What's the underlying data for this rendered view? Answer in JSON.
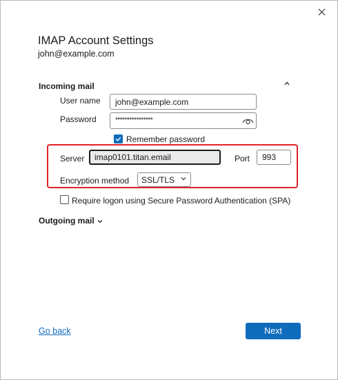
{
  "dialog": {
    "close_icon": "close-icon",
    "title": "IMAP Account Settings",
    "account_email": "john@example.com"
  },
  "incoming": {
    "heading": "Incoming mail",
    "collapse_icon": "chevron-up-icon",
    "user_name_label": "User name",
    "user_name_value": "john@example.com",
    "password_label": "Password",
    "password_value": "****************",
    "reveal_icon": "eye-icon",
    "remember_password_label": "Remember password",
    "remember_password_checked": true,
    "server_label": "Server",
    "server_value": "imap0101.titan.email",
    "port_label": "Port",
    "port_value": "993",
    "encryption_label": "Encryption method",
    "encryption_value": "SSL/TLS",
    "spa_label": "Require logon using Secure Password Authentication (SPA)",
    "spa_checked": false
  },
  "outgoing": {
    "heading": "Outgoing mail",
    "expand_icon": "chevron-down-icon"
  },
  "footer": {
    "back_label": "Go back",
    "next_label": "Next"
  },
  "colors": {
    "accent": "#0f6cbd",
    "highlight": "#e0222a"
  }
}
